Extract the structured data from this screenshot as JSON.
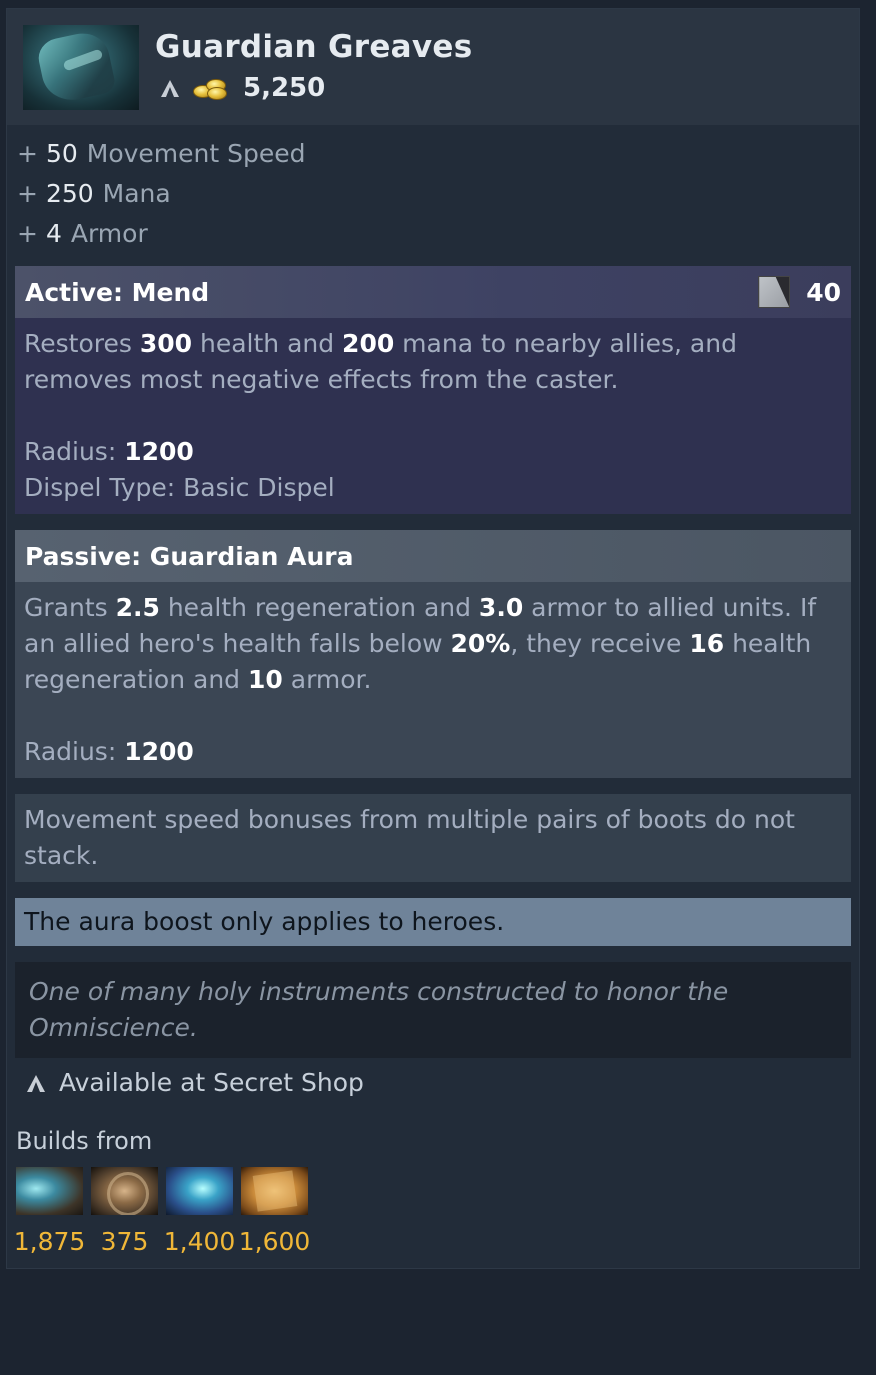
{
  "item": {
    "name": "Guardian Greaves",
    "cost": "5,250"
  },
  "stats": [
    {
      "plus": "+",
      "value": "50",
      "label": "Movement Speed"
    },
    {
      "plus": "+",
      "value": "250",
      "label": "Mana"
    },
    {
      "plus": "+",
      "value": "4",
      "label": "Armor"
    }
  ],
  "active": {
    "title": "Active: Mend",
    "cooldown": "40",
    "desc_parts": [
      "Restores ",
      "300",
      " health and ",
      "200",
      " mana to nearby allies, and removes most negative effects from the caster."
    ],
    "radius_label": "Radius: ",
    "radius_value": "1200",
    "dispel_label": "Dispel Type: Basic Dispel"
  },
  "passive": {
    "title": "Passive: Guardian Aura",
    "desc_parts": [
      "Grants ",
      "2.5",
      " health regeneration and ",
      "3.0",
      " armor to allied units. If an allied hero's health falls below ",
      "20%",
      ", they receive ",
      "16",
      " health regeneration and ",
      "10",
      " armor."
    ],
    "radius_label": "Radius: ",
    "radius_value": "1200"
  },
  "note": "Movement speed bonuses from multiple pairs of boots do not stack.",
  "aura_note": "The aura boost only applies to heroes.",
  "lore": "One of many holy instruments constructed to honor the Omniscience.",
  "availability": "Available at Secret Shop",
  "builds_from": {
    "label": "Builds from",
    "components": [
      {
        "icon": "arcane-boots-icon",
        "cost": "1,875"
      },
      {
        "icon": "buckler-icon",
        "cost": "375"
      },
      {
        "icon": "mekansm-icon",
        "cost": "1,400"
      },
      {
        "icon": "recipe-scroll-icon",
        "cost": "1,600"
      }
    ]
  },
  "colors": {
    "background": "#1c2430",
    "active_panel": "#2f3150",
    "passive_panel": "#3b4654",
    "aura_note": "#6f8399",
    "gold": "#f0b738"
  }
}
